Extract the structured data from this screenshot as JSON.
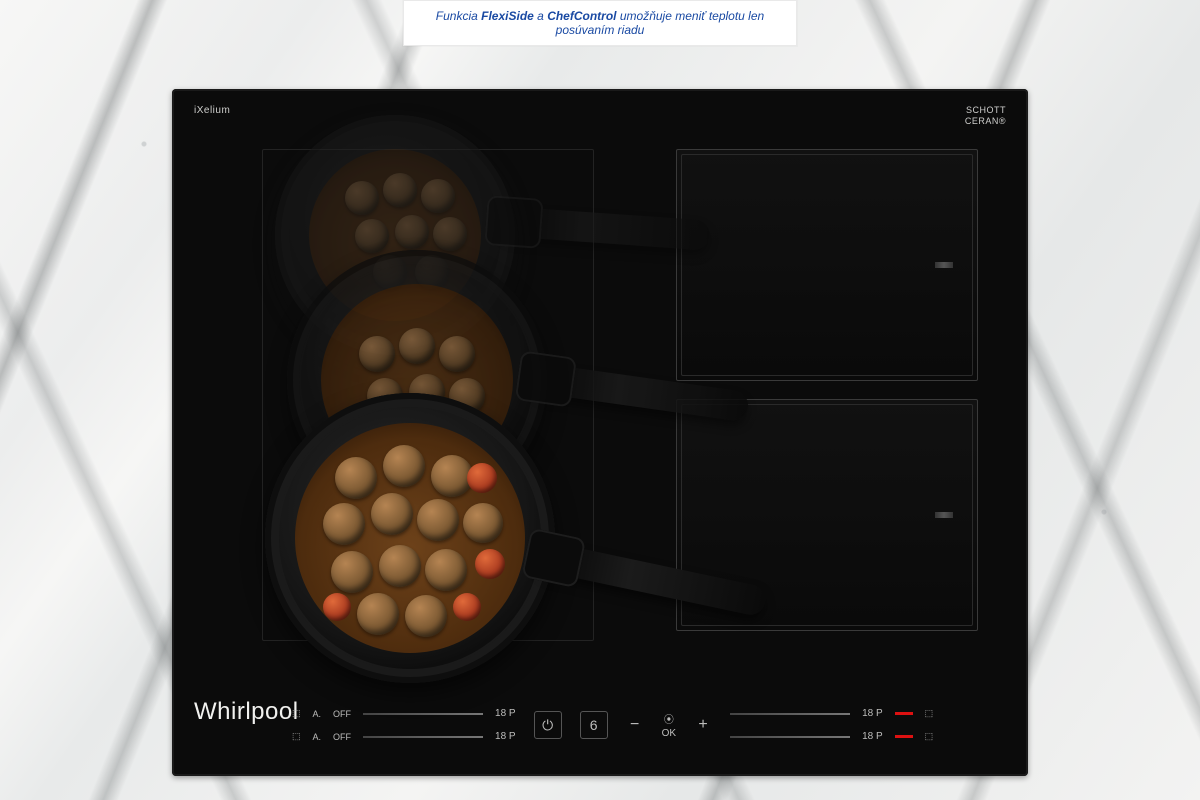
{
  "caption": {
    "prefix": "Funkcia ",
    "bold1": "FlexiSide",
    "mid": " a ",
    "bold2": "ChefControl",
    "suffix": " umožňuje meniť teplotu len posúvaním riadu"
  },
  "cooktop": {
    "cornerLeft": "iXelium",
    "cornerRightLine1": "SCHOTT",
    "cornerRightLine2": "CERAN®",
    "brand": "Whirlpool"
  },
  "controls": {
    "leftDigitTop": "A.",
    "leftDigitBottom": "A.",
    "off": "OFF",
    "p18": "18 P",
    "okLabel": "OK",
    "sixthSense": "6"
  }
}
